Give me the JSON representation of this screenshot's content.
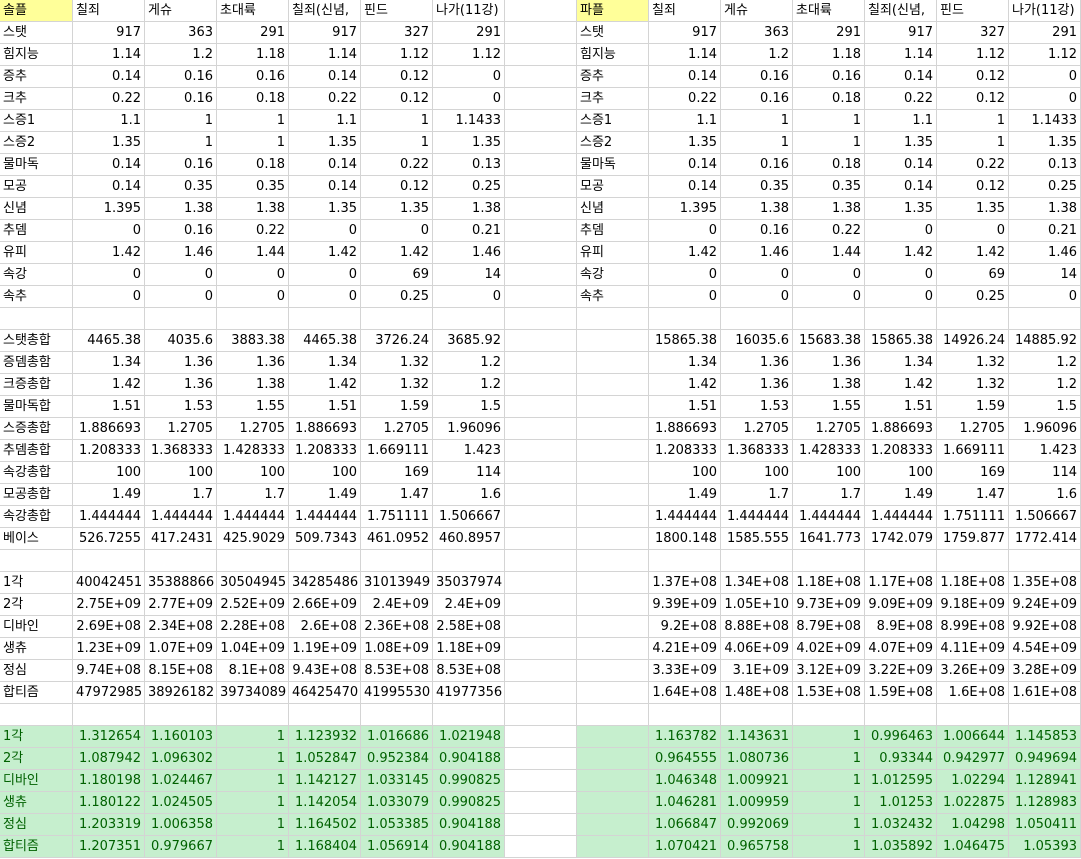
{
  "columns": {
    "left": [
      "솔플",
      "칠죄",
      "게슈",
      "초대륙",
      "칠죄(신념,",
      "핀드",
      "나가(11강)"
    ],
    "right": [
      "파플",
      "칠죄",
      "게슈",
      "초대륙",
      "칠죄(신념,",
      "핀드",
      "나가(11강)"
    ]
  },
  "rows": [
    {
      "label": "스탯",
      "left": [
        "917",
        "363",
        "291",
        "917",
        "327",
        "291"
      ],
      "rlabel": "스탯",
      "right": [
        "917",
        "363",
        "291",
        "917",
        "327",
        "291"
      ]
    },
    {
      "label": "힘지능",
      "left": [
        "1.14",
        "1.2",
        "1.18",
        "1.14",
        "1.12",
        "1.12"
      ],
      "rlabel": "힘지능",
      "right": [
        "1.14",
        "1.2",
        "1.18",
        "1.14",
        "1.12",
        "1.12"
      ]
    },
    {
      "label": "증추",
      "left": [
        "0.14",
        "0.16",
        "0.16",
        "0.14",
        "0.12",
        "0"
      ],
      "rlabel": "증추",
      "right": [
        "0.14",
        "0.16",
        "0.16",
        "0.14",
        "0.12",
        "0"
      ]
    },
    {
      "label": "크추",
      "left": [
        "0.22",
        "0.16",
        "0.18",
        "0.22",
        "0.12",
        "0"
      ],
      "rlabel": "크추",
      "right": [
        "0.22",
        "0.16",
        "0.18",
        "0.22",
        "0.12",
        "0"
      ]
    },
    {
      "label": "스증1",
      "left": [
        "1.1",
        "1",
        "1",
        "1.1",
        "1",
        "1.1433"
      ],
      "rlabel": "스증1",
      "right": [
        "1.1",
        "1",
        "1",
        "1.1",
        "1",
        "1.1433"
      ]
    },
    {
      "label": "스증2",
      "left": [
        "1.35",
        "1",
        "1",
        "1.35",
        "1",
        "1.35"
      ],
      "rlabel": "스증2",
      "right": [
        "1.35",
        "1",
        "1",
        "1.35",
        "1",
        "1.35"
      ]
    },
    {
      "label": "물마독",
      "left": [
        "0.14",
        "0.16",
        "0.18",
        "0.14",
        "0.22",
        "0.13"
      ],
      "rlabel": "물마독",
      "right": [
        "0.14",
        "0.16",
        "0.18",
        "0.14",
        "0.22",
        "0.13"
      ]
    },
    {
      "label": "모공",
      "left": [
        "0.14",
        "0.35",
        "0.35",
        "0.14",
        "0.12",
        "0.25"
      ],
      "rlabel": "모공",
      "right": [
        "0.14",
        "0.35",
        "0.35",
        "0.14",
        "0.12",
        "0.25"
      ]
    },
    {
      "label": "신념",
      "left": [
        "1.395",
        "1.38",
        "1.38",
        "1.35",
        "1.35",
        "1.38"
      ],
      "rlabel": "신념",
      "right": [
        "1.395",
        "1.38",
        "1.38",
        "1.35",
        "1.35",
        "1.38"
      ]
    },
    {
      "label": "추뎀",
      "left": [
        "0",
        "0.16",
        "0.22",
        "0",
        "0",
        "0.21"
      ],
      "rlabel": "추뎀",
      "right": [
        "0",
        "0.16",
        "0.22",
        "0",
        "0",
        "0.21"
      ]
    },
    {
      "label": "유피",
      "left": [
        "1.42",
        "1.46",
        "1.44",
        "1.42",
        "1.42",
        "1.46"
      ],
      "rlabel": "유피",
      "right": [
        "1.42",
        "1.46",
        "1.44",
        "1.42",
        "1.42",
        "1.46"
      ]
    },
    {
      "label": "속강",
      "left": [
        "0",
        "0",
        "0",
        "0",
        "69",
        "14"
      ],
      "rlabel": "속강",
      "right": [
        "0",
        "0",
        "0",
        "0",
        "69",
        "14"
      ]
    },
    {
      "label": "속추",
      "left": [
        "0",
        "0",
        "0",
        "0",
        "0.25",
        "0"
      ],
      "rlabel": "속추",
      "right": [
        "0",
        "0",
        "0",
        "0",
        "0.25",
        "0"
      ]
    },
    {
      "label": "",
      "left": [
        "",
        "",
        "",
        "",
        "",
        ""
      ],
      "rlabel": "",
      "right": [
        "",
        "",
        "",
        "",
        "",
        ""
      ]
    },
    {
      "label": "스탯총합",
      "left": [
        "4465.38",
        "4035.6",
        "3883.38",
        "4465.38",
        "3726.24",
        "3685.92"
      ],
      "rlabel": "",
      "right": [
        "15865.38",
        "16035.6",
        "15683.38",
        "15865.38",
        "14926.24",
        "14885.92"
      ]
    },
    {
      "label": "증뎀총함",
      "left": [
        "1.34",
        "1.36",
        "1.36",
        "1.34",
        "1.32",
        "1.2"
      ],
      "rlabel": "",
      "right": [
        "1.34",
        "1.36",
        "1.36",
        "1.34",
        "1.32",
        "1.2"
      ]
    },
    {
      "label": "크증총합",
      "left": [
        "1.42",
        "1.36",
        "1.38",
        "1.42",
        "1.32",
        "1.2"
      ],
      "rlabel": "",
      "right": [
        "1.42",
        "1.36",
        "1.38",
        "1.42",
        "1.32",
        "1.2"
      ]
    },
    {
      "label": "물마독합",
      "left": [
        "1.51",
        "1.53",
        "1.55",
        "1.51",
        "1.59",
        "1.5"
      ],
      "rlabel": "",
      "right": [
        "1.51",
        "1.53",
        "1.55",
        "1.51",
        "1.59",
        "1.5"
      ]
    },
    {
      "label": "스증총합",
      "left": [
        "1.886693",
        "1.2705",
        "1.2705",
        "1.886693",
        "1.2705",
        "1.96096"
      ],
      "rlabel": "",
      "right": [
        "1.886693",
        "1.2705",
        "1.2705",
        "1.886693",
        "1.2705",
        "1.96096"
      ]
    },
    {
      "label": "추뎀총합",
      "left": [
        "1.208333",
        "1.368333",
        "1.428333",
        "1.208333",
        "1.669111",
        "1.423"
      ],
      "rlabel": "",
      "right": [
        "1.208333",
        "1.368333",
        "1.428333",
        "1.208333",
        "1.669111",
        "1.423"
      ]
    },
    {
      "label": "속강총합",
      "left": [
        "100",
        "100",
        "100",
        "100",
        "169",
        "114"
      ],
      "rlabel": "",
      "right": [
        "100",
        "100",
        "100",
        "100",
        "169",
        "114"
      ]
    },
    {
      "label": "모공총합",
      "left": [
        "1.49",
        "1.7",
        "1.7",
        "1.49",
        "1.47",
        "1.6"
      ],
      "rlabel": "",
      "right": [
        "1.49",
        "1.7",
        "1.7",
        "1.49",
        "1.47",
        "1.6"
      ]
    },
    {
      "label": "속강총합",
      "left": [
        "1.444444",
        "1.444444",
        "1.444444",
        "1.444444",
        "1.751111",
        "1.506667"
      ],
      "rlabel": "",
      "right": [
        "1.444444",
        "1.444444",
        "1.444444",
        "1.444444",
        "1.751111",
        "1.506667"
      ]
    },
    {
      "label": "베이스",
      "left": [
        "526.7255",
        "417.2431",
        "425.9029",
        "509.7343",
        "461.0952",
        "460.8957"
      ],
      "rlabel": "",
      "right": [
        "1800.148",
        "1585.555",
        "1641.773",
        "1742.079",
        "1759.877",
        "1772.414"
      ]
    },
    {
      "label": "",
      "left": [
        "",
        "",
        "",
        "",
        "",
        ""
      ],
      "rlabel": "",
      "right": [
        "",
        "",
        "",
        "",
        "",
        ""
      ]
    },
    {
      "label": "1각",
      "left": [
        "40042451",
        "35388866",
        "30504945",
        "34285486",
        "31013949",
        "35037974"
      ],
      "rlabel": "",
      "right": [
        "1.37E+08",
        "1.34E+08",
        "1.18E+08",
        "1.17E+08",
        "1.18E+08",
        "1.35E+08"
      ]
    },
    {
      "label": "2각",
      "left": [
        "2.75E+09",
        "2.77E+09",
        "2.52E+09",
        "2.66E+09",
        "2.4E+09",
        "2.4E+09"
      ],
      "rlabel": "",
      "right": [
        "9.39E+09",
        "1.05E+10",
        "9.73E+09",
        "9.09E+09",
        "9.18E+09",
        "9.24E+09"
      ]
    },
    {
      "label": "디바인",
      "left": [
        "2.69E+08",
        "2.34E+08",
        "2.28E+08",
        "2.6E+08",
        "2.36E+08",
        "2.58E+08"
      ],
      "rlabel": "",
      "right": [
        "9.2E+08",
        "8.88E+08",
        "8.79E+08",
        "8.9E+08",
        "8.99E+08",
        "9.92E+08"
      ]
    },
    {
      "label": "생츄",
      "left": [
        "1.23E+09",
        "1.07E+09",
        "1.04E+09",
        "1.19E+09",
        "1.08E+09",
        "1.18E+09"
      ],
      "rlabel": "",
      "right": [
        "4.21E+09",
        "4.06E+09",
        "4.02E+09",
        "4.07E+09",
        "4.11E+09",
        "4.54E+09"
      ]
    },
    {
      "label": "정심",
      "left": [
        "9.74E+08",
        "8.15E+08",
        "8.1E+08",
        "9.43E+08",
        "8.53E+08",
        "8.53E+08"
      ],
      "rlabel": "",
      "right": [
        "3.33E+09",
        "3.1E+09",
        "3.12E+09",
        "3.22E+09",
        "3.26E+09",
        "3.28E+09"
      ]
    },
    {
      "label": "합티즘",
      "left": [
        "47972985",
        "38926182",
        "39734089",
        "46425470",
        "41995530",
        "41977356"
      ],
      "rlabel": "",
      "right": [
        "1.64E+08",
        "1.48E+08",
        "1.53E+08",
        "1.59E+08",
        "1.6E+08",
        "1.61E+08"
      ]
    },
    {
      "label": "",
      "left": [
        "",
        "",
        "",
        "",
        "",
        ""
      ],
      "rlabel": "",
      "right": [
        "",
        "",
        "",
        "",
        "",
        ""
      ]
    }
  ],
  "ratio_rows": [
    {
      "label": "1각",
      "left": [
        "1.312654",
        "1.160103",
        "1",
        "1.123932",
        "1.016686",
        "1.021948"
      ],
      "right": [
        "1.163782",
        "1.143631",
        "1",
        "0.996463",
        "1.006644",
        "1.145853"
      ]
    },
    {
      "label": "2각",
      "left": [
        "1.087942",
        "1.096302",
        "1",
        "1.052847",
        "0.952384",
        "0.904188"
      ],
      "right": [
        "0.964555",
        "1.080736",
        "1",
        "0.93344",
        "0.942977",
        "0.949694"
      ]
    },
    {
      "label": "디바인",
      "left": [
        "1.180198",
        "1.024467",
        "1",
        "1.142127",
        "1.033145",
        "0.990825"
      ],
      "right": [
        "1.046348",
        "1.009921",
        "1",
        "1.012595",
        "1.02294",
        "1.128941"
      ]
    },
    {
      "label": "생츄",
      "left": [
        "1.180122",
        "1.024505",
        "1",
        "1.142054",
        "1.033079",
        "0.990825"
      ],
      "right": [
        "1.046281",
        "1.009959",
        "1",
        "1.01253",
        "1.022875",
        "1.128983"
      ]
    },
    {
      "label": "정심",
      "left": [
        "1.203319",
        "1.006358",
        "1",
        "1.164502",
        "1.053385",
        "0.904188"
      ],
      "right": [
        "1.066847",
        "0.992069",
        "1",
        "1.032432",
        "1.04298",
        "1.050411"
      ]
    },
    {
      "label": "합티즘",
      "left": [
        "1.207351",
        "0.979667",
        "1",
        "1.168404",
        "1.056914",
        "0.904188"
      ],
      "right": [
        "1.070421",
        "0.965758",
        "1",
        "1.035892",
        "1.046475",
        "1.05393"
      ]
    }
  ],
  "colors": {
    "header_highlight": "#ffff99",
    "ratio_fill": "#c6efce",
    "ratio_text": "#006100",
    "gridline": "#d4d4d4"
  }
}
